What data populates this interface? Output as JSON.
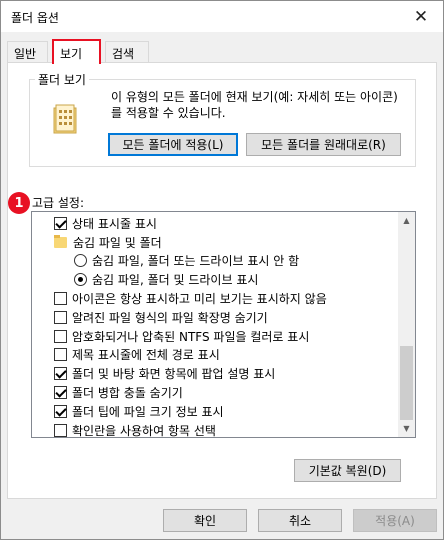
{
  "window": {
    "title": "폴더 옵션",
    "close_glyph": "✕"
  },
  "tabs": [
    {
      "label": "일반"
    },
    {
      "label": "보기"
    },
    {
      "label": "검색"
    }
  ],
  "folder_views": {
    "legend": "폴더 보기",
    "description": "이 유형의 모든 폴더에 현재 보기(예: 자세히 또는 아이콘)를 적용할 수 있습니다.",
    "apply_button": "모든 폴더에 적용(L)",
    "reset_button": "모든 폴더를 원래대로(R)"
  },
  "advanced": {
    "badge": "1",
    "label": "고급 설정:",
    "items": [
      {
        "type": "checkbox",
        "checked": true,
        "label": "상태 표시줄 표시"
      },
      {
        "type": "folder",
        "label": "숨김 파일 및 폴더"
      },
      {
        "type": "radio",
        "checked": false,
        "label": "숨김 파일, 폴더 또는 드라이브 표시 안 함"
      },
      {
        "type": "radio",
        "checked": true,
        "label": "숨김 파일, 폴더 및 드라이브 표시"
      },
      {
        "type": "checkbox",
        "checked": false,
        "label": "아이콘은 항상 표시하고 미리 보기는 표시하지 않음"
      },
      {
        "type": "checkbox",
        "checked": false,
        "label": "알려진 파일 형식의 파일 확장명 숨기기"
      },
      {
        "type": "checkbox",
        "checked": false,
        "label": "암호화되거나 압축된 NTFS 파일을 컬러로 표시"
      },
      {
        "type": "checkbox",
        "checked": false,
        "label": "제목 표시줄에 전체 경로 표시"
      },
      {
        "type": "checkbox",
        "checked": true,
        "label": "폴더 및 바탕 화면 항목에 팝업 설명 표시"
      },
      {
        "type": "checkbox",
        "checked": true,
        "label": "폴더 병합 충돌 숨기기"
      },
      {
        "type": "checkbox",
        "checked": true,
        "label": "폴더 팁에 파일 크기 정보 표시"
      },
      {
        "type": "checkbox",
        "checked": false,
        "label": "확인란을 사용하여 항목 선택"
      }
    ],
    "restore_button": "기본값 복원(D)"
  },
  "footer": {
    "ok": "확인",
    "cancel": "취소",
    "apply": "적용(A)"
  },
  "colors": {
    "accent": "#0078d7",
    "highlight": "#e81123"
  }
}
